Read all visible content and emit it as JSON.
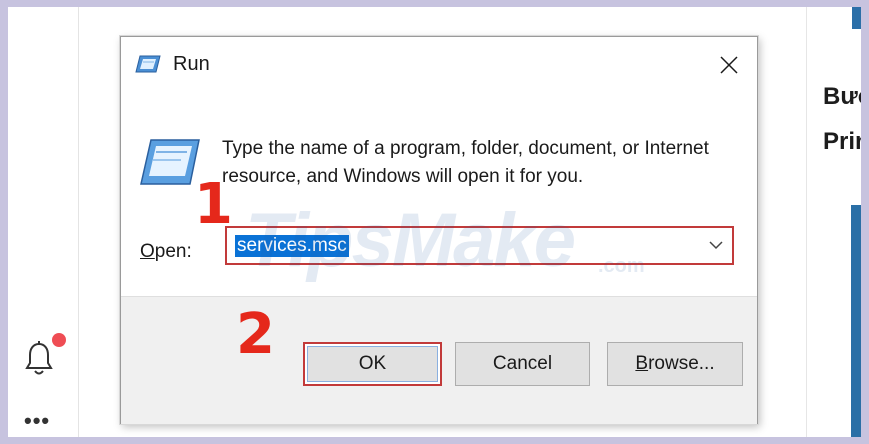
{
  "dialog": {
    "title": "Run",
    "description": "Type the name of a program, folder, document, or Internet resource, and Windows will open it for you.",
    "open_label_u": "O",
    "open_label_rest": "pen:",
    "open_value": "services.msc",
    "buttons": {
      "ok": "OK",
      "cancel": "Cancel",
      "browse_u": "B",
      "browse_rest": "rowse..."
    }
  },
  "annotations": {
    "step1": "1",
    "step2": "2"
  },
  "right_panel": {
    "line1": "Bước",
    "line2": "Prin"
  },
  "left_rail": {
    "more_glyph": "•••"
  },
  "watermark": {
    "main": "TipsMake",
    "suffix": ".com"
  },
  "colors": {
    "highlight_red": "#c23a3a",
    "selection_blue": "#0a72d6",
    "step_red": "#e5281b",
    "notification_dot": "#ef4d54"
  }
}
